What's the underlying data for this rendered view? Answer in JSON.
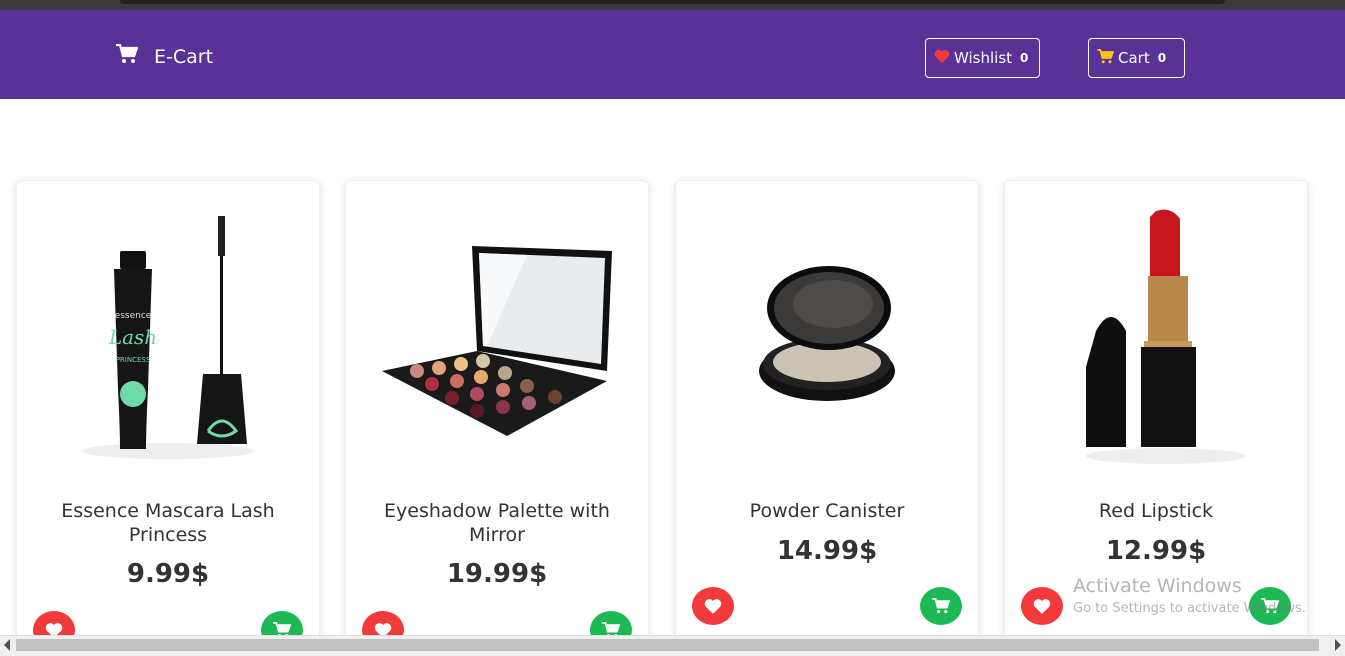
{
  "brand": {
    "name": "E-Cart",
    "icon": "shopping-cart-icon"
  },
  "header": {
    "wishlist": {
      "label": "Wishlist",
      "count": "0",
      "icon": "heart-icon"
    },
    "cart": {
      "label": "Cart",
      "count": "0",
      "icon": "shopping-cart-icon"
    }
  },
  "colors": {
    "nav_bg": "#5a3196",
    "heart_red": "#f23a3a",
    "cart_green": "#1db954",
    "cart_icon_yellow": "#f5c518"
  },
  "products": [
    {
      "title": "Essence Mascara Lash Princess",
      "price": "9.99$"
    },
    {
      "title": "Eyeshadow Palette with Mirror",
      "price": "19.99$"
    },
    {
      "title": "Powder Canister",
      "price": "14.99$"
    },
    {
      "title": "Red Lipstick",
      "price": "12.99$"
    }
  ],
  "image_texts": {
    "mascara_brand": "essence",
    "mascara_name": "Lash",
    "mascara_sub": "PRINCESS"
  },
  "watermark": {
    "line1": "Activate Windows",
    "line2": "Go to Settings to activate Windows."
  }
}
